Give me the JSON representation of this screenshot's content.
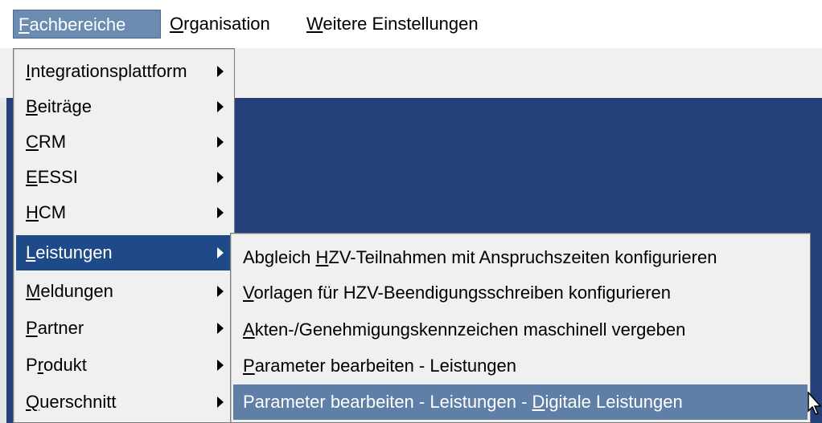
{
  "menubar": {
    "items": [
      {
        "pre": "",
        "key": "F",
        "post": "achbereiche"
      },
      {
        "pre": "",
        "key": "O",
        "post": "rganisation"
      },
      {
        "pre": "",
        "key": "W",
        "post": "eitere Einstellungen"
      }
    ]
  },
  "fachbereiche_menu": {
    "items": [
      {
        "pre": "",
        "key": "I",
        "post": "ntegrationsplattform"
      },
      {
        "pre": "",
        "key": "B",
        "post": "eiträge"
      },
      {
        "pre": "",
        "key": "C",
        "post": "RM"
      },
      {
        "pre": "",
        "key": "E",
        "post": "ESSI"
      },
      {
        "pre": "",
        "key": "H",
        "post": "CM"
      },
      {
        "pre": "",
        "key": "L",
        "post": "eistungen"
      },
      {
        "pre": "",
        "key": "M",
        "post": "eldungen"
      },
      {
        "pre": "",
        "key": "P",
        "post": "artner"
      },
      {
        "pre": "P",
        "key": "r",
        "post": "odukt"
      },
      {
        "pre": "",
        "key": "Q",
        "post": "uerschnitt"
      }
    ]
  },
  "leistungen_submenu": {
    "items": [
      {
        "pre": "Abgleich ",
        "key": "H",
        "post": "ZV-Teilnahmen mit Anspruchszeiten konfigurieren"
      },
      {
        "pre": "",
        "key": "V",
        "post": "orlagen für HZV-Beendigungsschreiben konfigurieren"
      },
      {
        "pre": "",
        "key": "A",
        "post": "kten-/Genehmigungskennzeichen maschinell vergeben"
      },
      {
        "pre": "",
        "key": "P",
        "post": "arameter bearbeiten - Leistungen"
      },
      {
        "pre": "Parameter bearbeiten - Leistungen - ",
        "key": "D",
        "post": "igitale Leistungen"
      }
    ]
  }
}
